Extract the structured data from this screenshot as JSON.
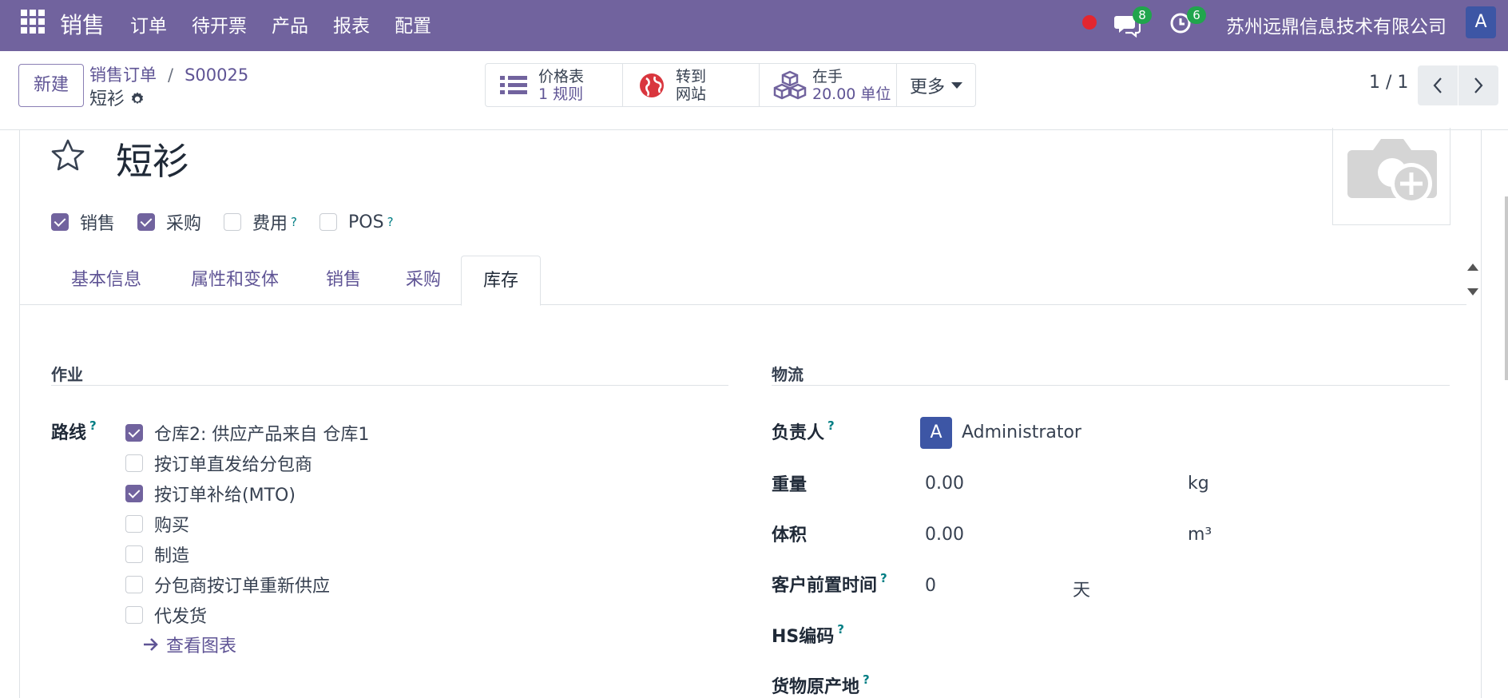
{
  "navbar": {
    "app_name": "销售",
    "menu": [
      "订单",
      "待开票",
      "产品",
      "报表",
      "配置"
    ],
    "chat_count": "8",
    "activity_count": "6",
    "company": "苏州远鼎信息技术有限公司",
    "user_initial": "A"
  },
  "control": {
    "new_label": "新建",
    "breadcrumb_parent": "销售订单",
    "breadcrumb_sep": "/",
    "breadcrumb_order": "S00025",
    "record_name": "短衫",
    "stats": {
      "pricelist_label": "价格表",
      "pricelist_value": "1 规则",
      "website_label": "转到",
      "website_value": "网站",
      "onhand_label": "在手",
      "onhand_value": "20.00 单位",
      "more_label": "更多"
    },
    "pager": "1 / 1"
  },
  "product": {
    "name": "短衫",
    "flags": [
      {
        "label": "销售",
        "checked": true,
        "help": false
      },
      {
        "label": "采购",
        "checked": true,
        "help": false
      },
      {
        "label": "费用",
        "checked": false,
        "help": true
      },
      {
        "label": "POS",
        "checked": false,
        "help": true
      }
    ]
  },
  "tabs": [
    "基本信息",
    "属性和变体",
    "销售",
    "采购",
    "库存"
  ],
  "active_tab": "库存",
  "operations": {
    "title": "作业",
    "routes_label": "路线",
    "routes": [
      {
        "label": "仓库2: 供应产品来自 仓库1",
        "checked": true
      },
      {
        "label": "按订单直发给分包商",
        "checked": false
      },
      {
        "label": "按订单补给(MTO)",
        "checked": true
      },
      {
        "label": "购买",
        "checked": false
      },
      {
        "label": "制造",
        "checked": false
      },
      {
        "label": "分包商按订单重新供应",
        "checked": false
      },
      {
        "label": "代发货",
        "checked": false
      }
    ],
    "diagram_link": "查看图表"
  },
  "logistics": {
    "title": "物流",
    "responsible_label": "负责人",
    "responsible_initial": "A",
    "responsible_value": "Administrator",
    "weight_label": "重量",
    "weight_value": "0.00",
    "weight_unit": "kg",
    "volume_label": "体积",
    "volume_value": "0.00",
    "volume_unit": "m³",
    "lead_label": "客户前置时间",
    "lead_value": "0",
    "lead_unit": "天",
    "hs_label": "HS编码",
    "origin_label": "货物原产地"
  },
  "colors": {
    "brand": "#71639e",
    "link": "#5f5495",
    "help": "#017e84",
    "badge": "#21a54d",
    "avatar": "#3d56a5"
  }
}
